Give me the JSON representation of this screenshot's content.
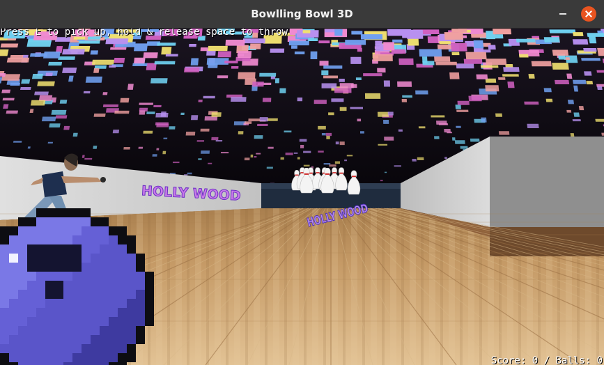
{
  "window": {
    "title": "Bowlling Bowl 3D"
  },
  "hud": {
    "hint": "Press E to pick up, hold & release space to throw",
    "score_label": "Score:",
    "score": "0",
    "separator": "/",
    "balls_label": "Balls:",
    "balls": "0"
  },
  "signs": {
    "left": "HOLLY WOOD",
    "right": "HOLLY WOOD"
  },
  "colors": {
    "titlebar": "#3a3a3a",
    "close_button": "#e95420",
    "ball": "#5a55c9",
    "floor": "#c9a06a",
    "wall": "#d8d8d8"
  }
}
